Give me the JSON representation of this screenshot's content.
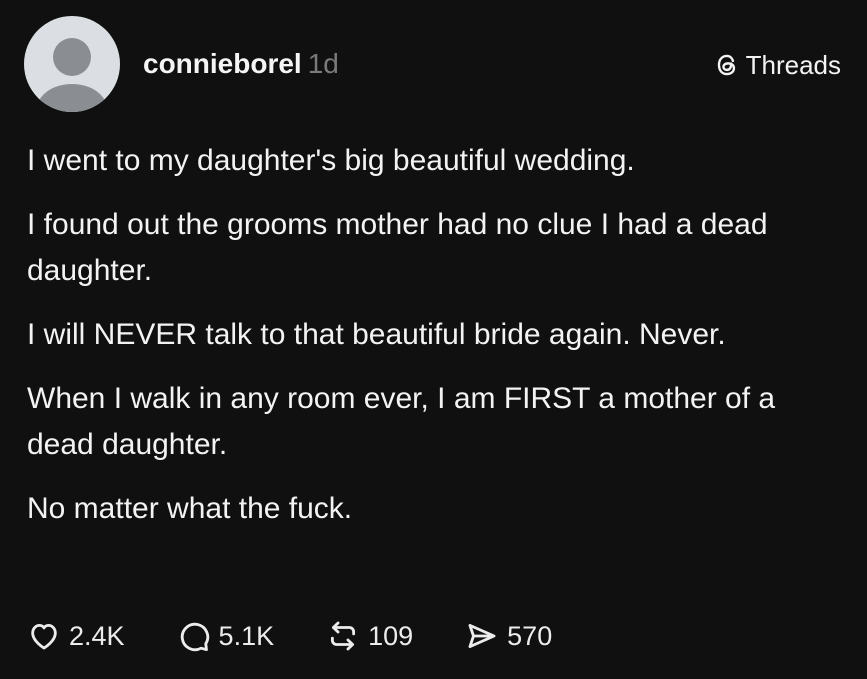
{
  "post": {
    "username": "connieborel",
    "timestamp": "1d",
    "brand": "Threads",
    "paragraphs": [
      "I went to my daughter's big beautiful wedding.",
      "I found out the grooms mother had no clue I had a dead daughter.",
      "I will NEVER talk to that beautiful bride again. Never.",
      "When I walk in any room ever, I am FIRST a mother of a dead daughter.",
      "No matter what the fuck."
    ],
    "actions": {
      "likes": "2.4K",
      "replies": "5.1K",
      "reposts": "109",
      "shares": "570"
    }
  },
  "icons": {
    "brand": "threads-logo-icon",
    "like": "heart-icon",
    "reply": "speech-bubble-icon",
    "repost": "repost-icon",
    "share": "send-icon"
  },
  "colors": {
    "background": "#101010",
    "text": "#f3f3f3",
    "muted": "#7a7a7a",
    "avatar_bg": "#dbdfe4",
    "avatar_fg": "#8a8e93"
  }
}
